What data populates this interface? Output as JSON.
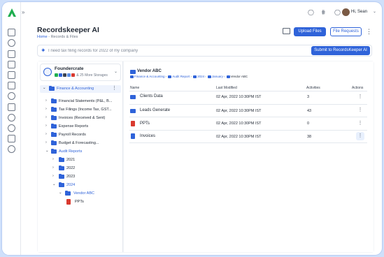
{
  "app": {
    "title": "Recordskeeper AI"
  },
  "topbar": {
    "greeting": "Hi, Sean"
  },
  "breadcrumb": {
    "home": "Home",
    "separator": "-",
    "current": "Records & Files"
  },
  "actions": {
    "upload": "Upload Files",
    "requests": "File Requests"
  },
  "ai": {
    "placeholder": "I need tax filing records for 2022 of my company",
    "submit": "Submit to RecordsKeeper AI"
  },
  "storage": {
    "name": "Foundercrate",
    "more": "& 25 More Storages"
  },
  "tree": {
    "selected": "Finance & Accounting",
    "items": [
      {
        "label": "Financial Statements (P&L, B..."
      },
      {
        "label": "Tax Filings (Income Tax, GST..."
      },
      {
        "label": "Invoices (Received & Sent)"
      },
      {
        "label": "Expense Reports"
      },
      {
        "label": "Payroll Records"
      },
      {
        "label": "Budget & Forecasting..."
      },
      {
        "label": "Audit Reports"
      }
    ],
    "years": [
      "2021",
      "2022",
      "2023",
      "2024"
    ],
    "vendor": "Vendor ABC",
    "file": "PPTs"
  },
  "content": {
    "folder": "Vendor ABC",
    "path": [
      "Finance & Accounting",
      "Audit Report",
      "2024",
      "January",
      "Vendor ABC"
    ],
    "columns": {
      "name": "Name",
      "modified": "Last Modified",
      "activities": "Activities",
      "actions": "Actions"
    },
    "rows": [
      {
        "name": "Clients Data",
        "modified": "02 Apr, 2022 10:30PM IST",
        "activities": "3",
        "type": "folder"
      },
      {
        "name": "Leads Generate",
        "modified": "02 Apr, 2022 10:30PM IST",
        "activities": "43",
        "type": "folder"
      },
      {
        "name": "PPTs",
        "modified": "02 Apr, 2022 10:30PM IST",
        "activities": "0",
        "type": "pdf"
      },
      {
        "name": "Invoices",
        "modified": "02 Apr, 2022 10:30PM IST",
        "activities": "38",
        "type": "doc"
      }
    ]
  },
  "colors": {
    "accent": "#2f63d9",
    "pdf": "#d93a2f",
    "frame": "#cfe0fb"
  }
}
